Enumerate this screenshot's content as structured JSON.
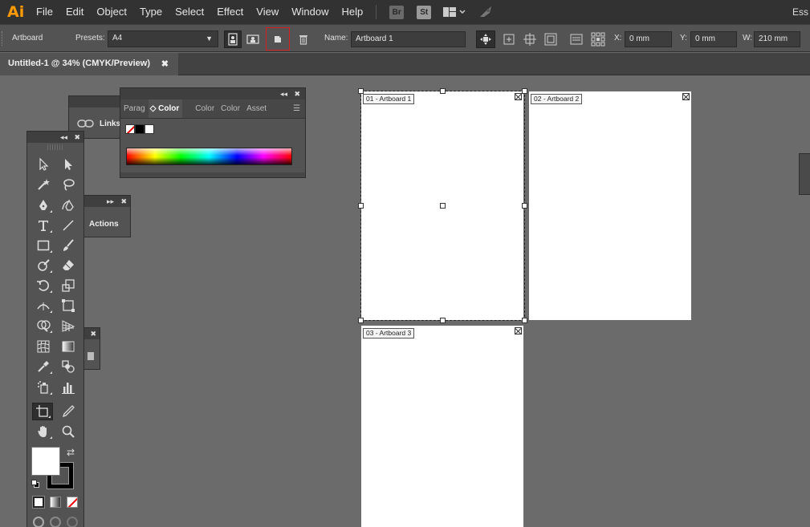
{
  "app": {
    "logo": "Ai",
    "workspace": "Ess"
  },
  "menu": [
    "File",
    "Edit",
    "Object",
    "Type",
    "Select",
    "Effect",
    "View",
    "Window",
    "Help"
  ],
  "bridge_badges": {
    "br": "Br",
    "st": "St"
  },
  "control": {
    "mode_label": "Artboard",
    "presets_label": "Presets:",
    "preset_value": "A4",
    "name_label": "Name:",
    "name_value": "Artboard 1",
    "x_label": "X:",
    "x_value": "0 mm",
    "y_label": "Y:",
    "y_value": "0 mm",
    "w_label": "W:",
    "w_value": "210 mm"
  },
  "document_tab": {
    "title": "Untitled-1 @ 34% (CMYK/Preview)",
    "close": "✖"
  },
  "panels": {
    "links": {
      "label": "Links"
    },
    "actions": {
      "label": "Actions"
    },
    "color": {
      "tabs": [
        "Parag",
        "Color",
        "Color",
        "Color",
        "Asset"
      ]
    }
  },
  "artboards": [
    {
      "label": "01 - Artboard 1"
    },
    {
      "label": "02 - Artboard 2"
    },
    {
      "label": "03 - Artboard 3"
    }
  ],
  "tools": [
    "selection-tool",
    "direct-selection-tool",
    "magic-wand-tool",
    "lasso-tool",
    "pen-tool",
    "curvature-tool",
    "type-tool",
    "line-segment-tool",
    "rectangle-tool",
    "paintbrush-tool",
    "shaper-tool",
    "eraser-tool",
    "rotate-tool",
    "scale-tool",
    "width-tool",
    "free-transform-tool",
    "shape-builder-tool",
    "perspective-grid-tool",
    "mesh-tool",
    "gradient-tool",
    "eyedropper-tool",
    "blend-tool",
    "symbol-sprayer-tool",
    "column-graph-tool",
    "artboard-tool",
    "slice-tool",
    "hand-tool",
    "zoom-tool"
  ]
}
